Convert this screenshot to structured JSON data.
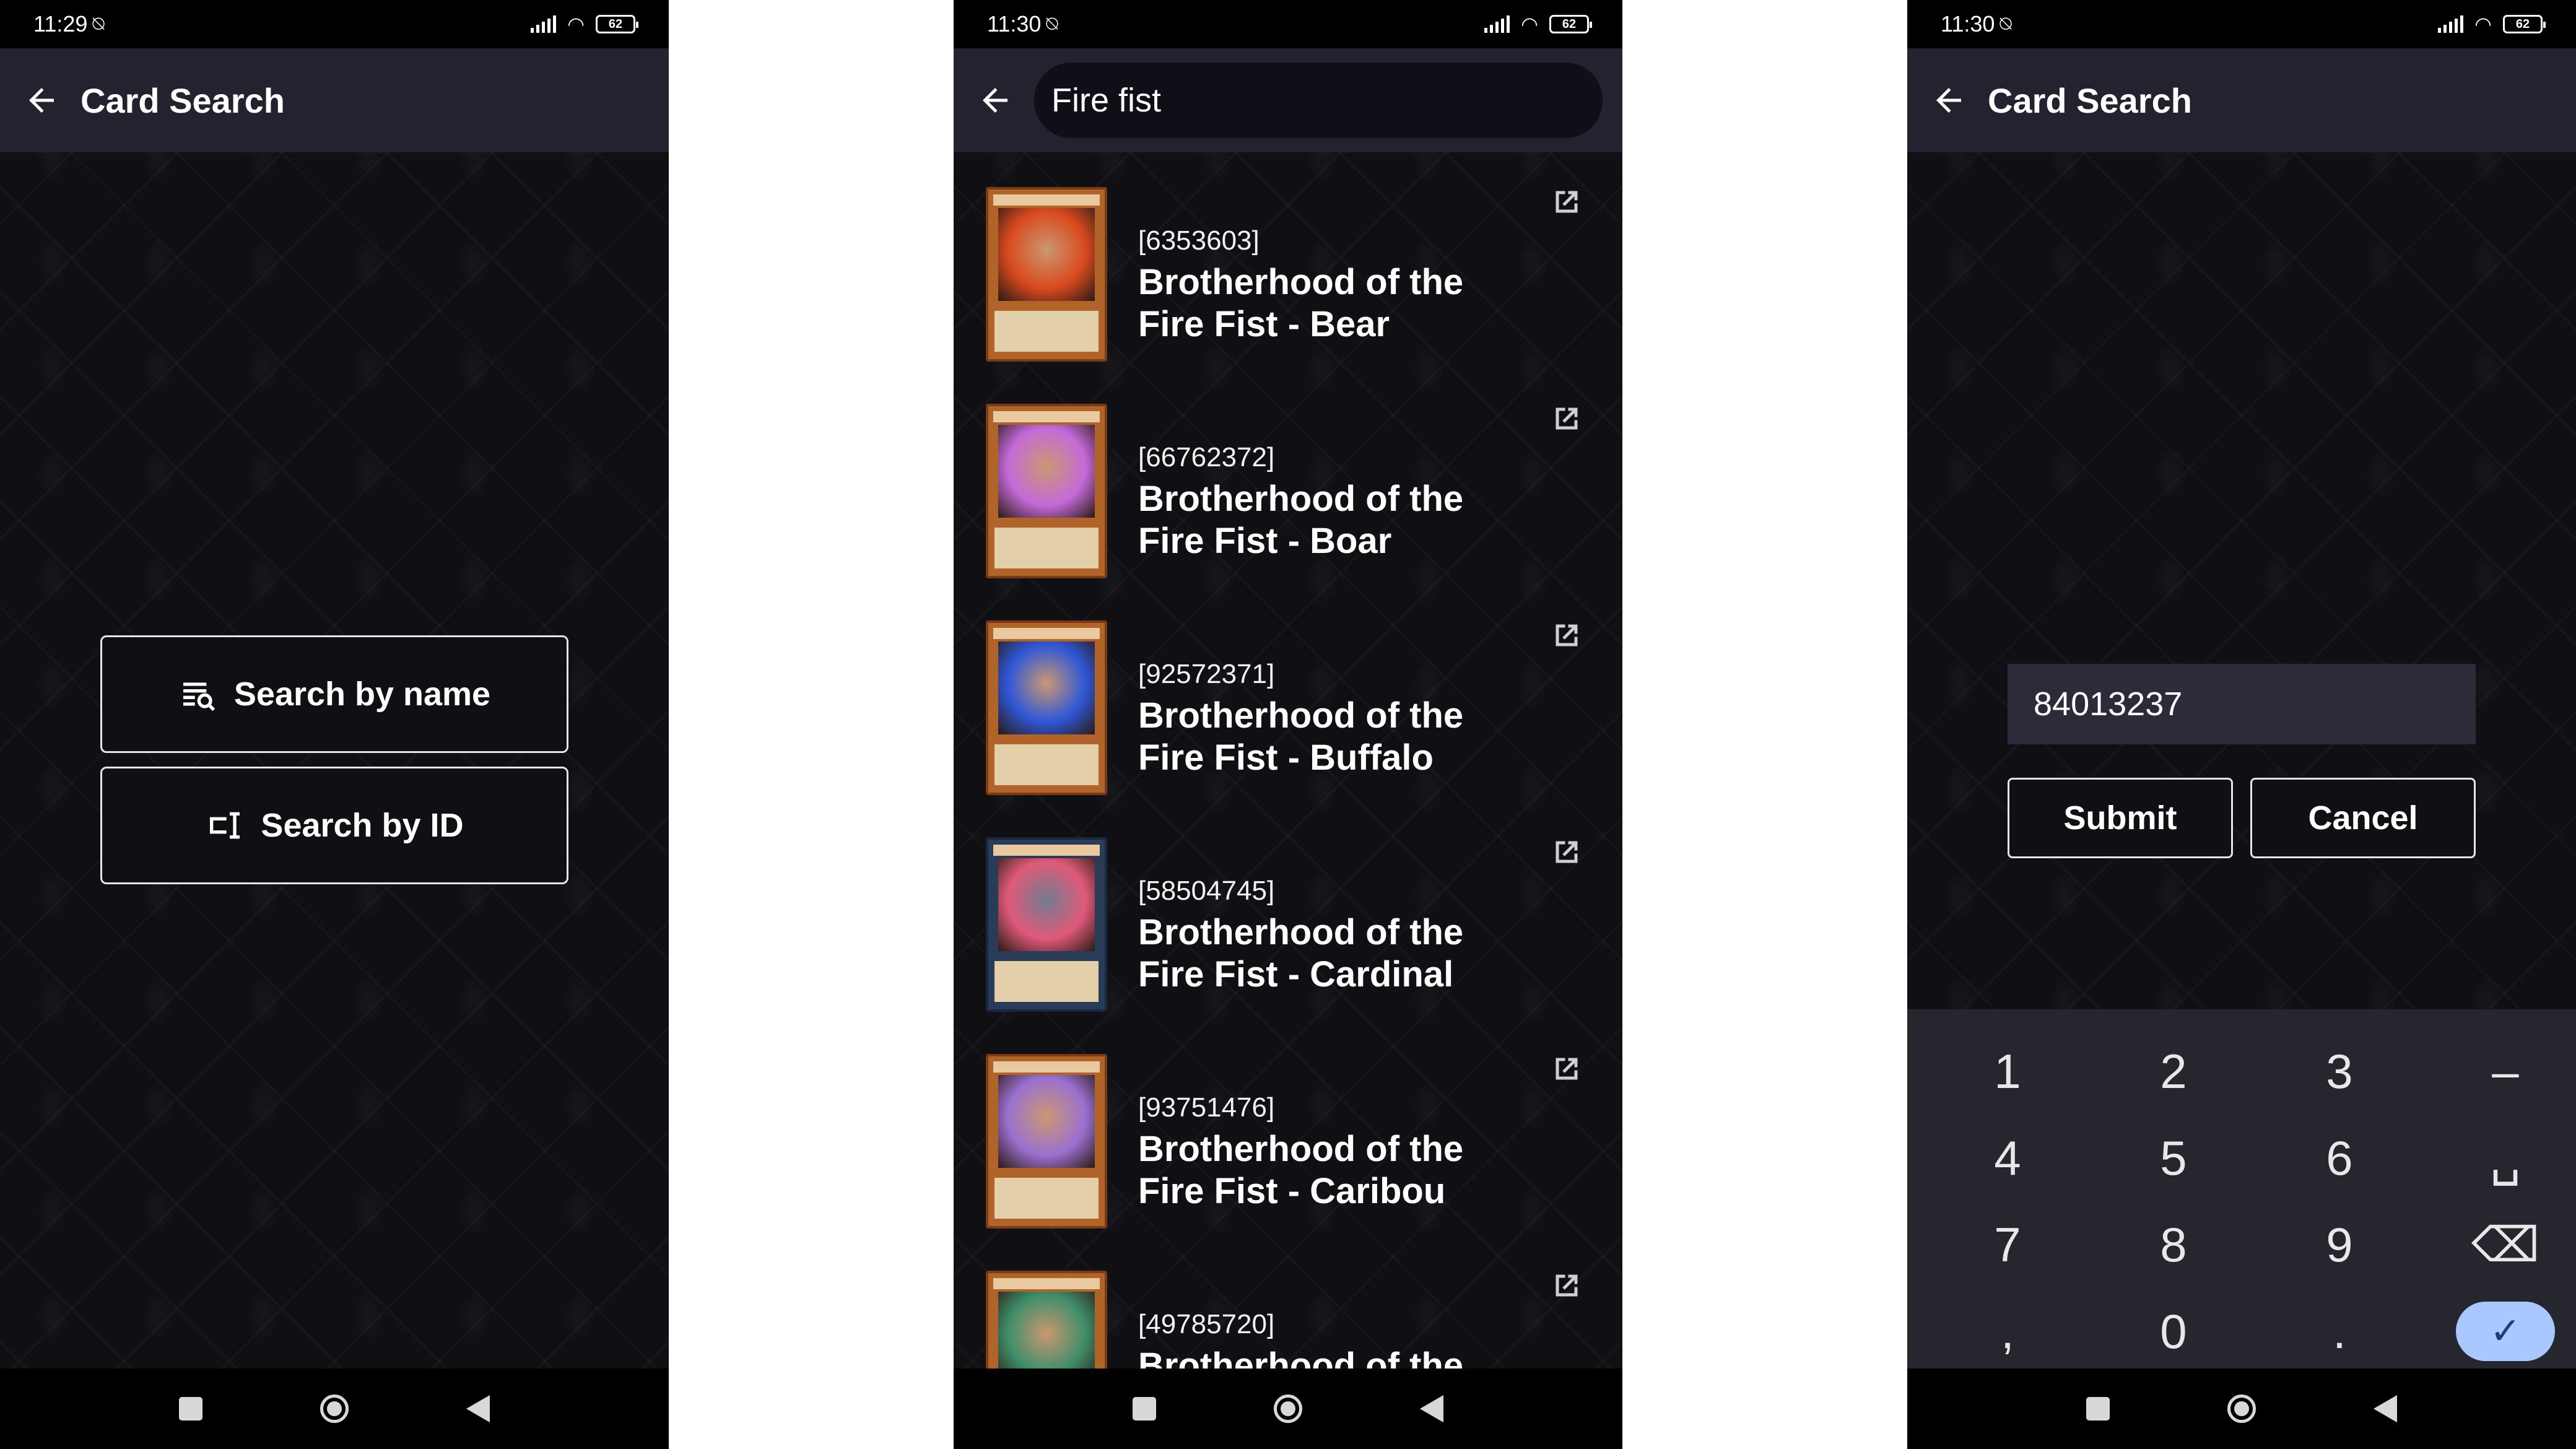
{
  "screens": [
    {
      "status": {
        "time": "11:29",
        "battery": "62"
      },
      "appbar": {
        "title": "Card Search"
      },
      "buttons": {
        "search_by_name": "Search by name",
        "search_by_id": "Search by ID"
      }
    },
    {
      "status": {
        "time": "11:30",
        "battery": "62"
      },
      "search": {
        "query": "Fire fist"
      },
      "results": [
        {
          "id": "[6353603]",
          "name_line1": "Brotherhood of the",
          "name_line2": "Fire Fist - Bear",
          "art_color": "#d94a1e"
        },
        {
          "id": "[66762372]",
          "name_line1": "Brotherhood of the",
          "name_line2": "Fire Fist - Boar",
          "art_color": "#c46ad8"
        },
        {
          "id": "[92572371]",
          "name_line1": "Brotherhood of the",
          "name_line2": "Fire Fist - Buffalo",
          "art_color": "#2f57d6"
        },
        {
          "id": "[58504745]",
          "name_line1": "Brotherhood of the",
          "name_line2": "Fire Fist - Cardinal",
          "art_color": "#e05a7a"
        },
        {
          "id": "[93751476]",
          "name_line1": "Brotherhood of the",
          "name_line2": "Fire Fist - Caribou",
          "art_color": "#9b70d0"
        },
        {
          "id": "[49785720]",
          "name_line1": "Brotherhood of the",
          "name_line2": "",
          "art_color": "#3f8e6a"
        }
      ]
    },
    {
      "status": {
        "time": "11:30",
        "battery": "62"
      },
      "appbar": {
        "title": "Card Search"
      },
      "dialog": {
        "input_value": "84013237",
        "submit_label": "Submit",
        "cancel_label": "Cancel"
      },
      "keypad": {
        "keys": [
          "1",
          "2",
          "3",
          "–",
          "4",
          "5",
          "6",
          "␣",
          "7",
          "8",
          "9",
          "⌫",
          ",",
          "0",
          ".",
          "✓"
        ]
      }
    }
  ]
}
